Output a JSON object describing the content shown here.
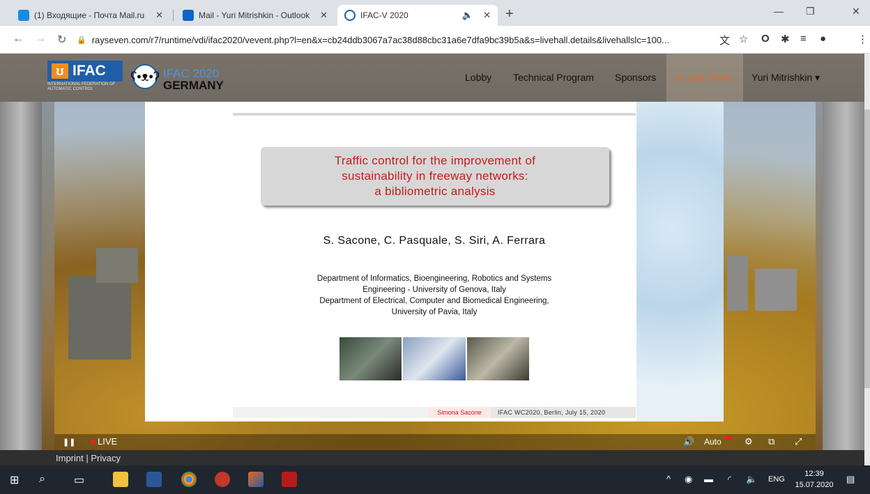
{
  "browser": {
    "tabs": [
      {
        "title": "(1) Входящие - Почта Mail.ru",
        "close": "✕",
        "active": false
      },
      {
        "title": "Mail - Yuri Mitrishkin - Outlook",
        "close": "✕",
        "active": false
      },
      {
        "title": "IFAC-V 2020",
        "close": "✕",
        "active": true
      }
    ],
    "mute_icon": "🔈",
    "new_tab": "+",
    "window_controls": {
      "minimize": "—",
      "restore": "❐",
      "close": "✕"
    },
    "url": "rayseven.com/r7/runtime/vdi/ifac2020/vevent.php?l=en&x=cb24ddb3067a7ac38d88cbc31a6e7dfa9bc39b5a&s=livehall.details&livehallslc=100..."
  },
  "site": {
    "ifac_logo": {
      "text": "IFAC",
      "subtitle": "International Federation of Automatic Control"
    },
    "event_logo": {
      "line1": "IFAC 2020",
      "line2": "GERMANY"
    },
    "nav": {
      "lobby": "Lobby",
      "technical_program": "Technical Program",
      "sponsors": "Sponsors",
      "live_track": "Live Track",
      "user": "Yuri Mitrishkin"
    },
    "footer": {
      "imprint": "Imprint | Privacy"
    }
  },
  "slide": {
    "title_lines": [
      "Traffic control for the improvement of",
      "sustainability in freeway networks:",
      "a bibliometric analysis"
    ],
    "authors": "S. Sacone, C. Pasquale, S. Siri, A. Ferrara",
    "affiliation_lines": [
      "Department of Informatics, Bioengineering, Robotics and Systems",
      "Engineering - University of Genova, Italy",
      "Department of Electrical, Computer and Biomedical Engineering,",
      "University of Pavia, Italy"
    ],
    "footer_name": "Simona Sacone",
    "footer_conference": "IFAC WC2020, Berlin, July 15, 2020"
  },
  "player": {
    "live_label": "LIVE",
    "quality": "Auto",
    "pause_icon": "❚❚",
    "volume_icon": "🔊",
    "settings_icon": "⚙",
    "pip_icon": "⧉",
    "fullscreen_icon": "⤢"
  },
  "taskbar": {
    "language": "ENG",
    "time": "12:39",
    "date": "15.07.2020"
  },
  "colors": {
    "slide_title_red": "#c81a1a",
    "live_track_orange": "#e06b2b",
    "ifac_blue": "#1f5fa8",
    "taskbar": "#1f2630"
  }
}
